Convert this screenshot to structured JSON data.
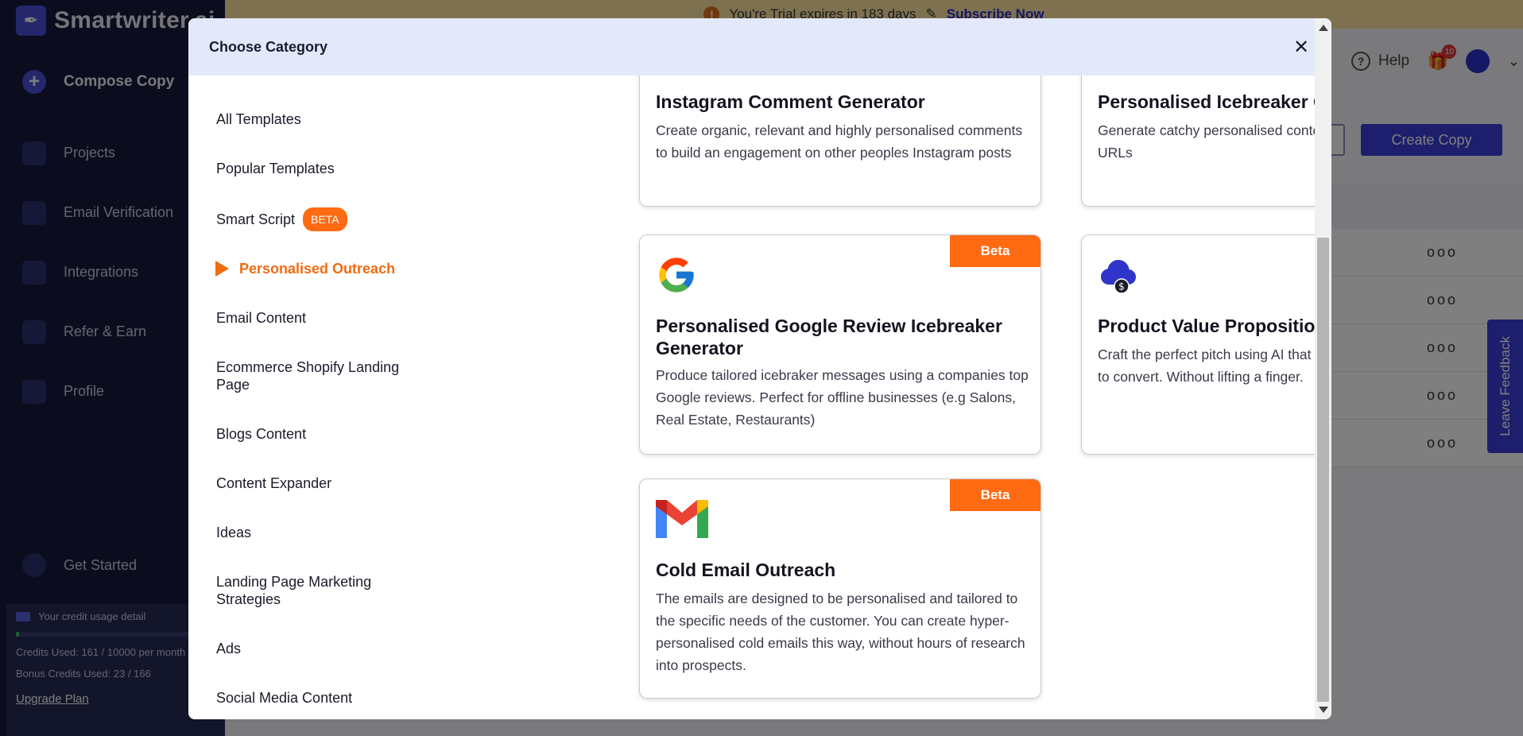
{
  "app": {
    "brand": "Smartwriter.ai",
    "compose_label": "Compose Copy",
    "nav": [
      "Projects",
      "Email Verification",
      "Integrations",
      "Refer & Earn",
      "Profile"
    ],
    "get_started": "Get Started",
    "credit": {
      "title": "Your credit usage detail",
      "credits_used": "Credits Used: 161 / 10000 per month",
      "bonus_used": "Bonus Credits Used: 23 / 166",
      "usage_fraction": 0.016,
      "upgrade": "Upgrade Plan"
    },
    "trial": {
      "message": "You're Trial expires in 183 days",
      "subscribe": "Subscribe Now"
    },
    "header": {
      "help": "Help",
      "gift_count": "10",
      "create_copy": "Create Copy"
    },
    "table_row_action": "ooo",
    "feedback": "Leave Feedback"
  },
  "modal": {
    "title": "Choose Category",
    "categories": [
      {
        "label": "All Templates"
      },
      {
        "label": "Popular Templates"
      },
      {
        "label": "Smart Script",
        "badge": "BETA"
      },
      {
        "label": "Personalised Outreach",
        "active": true
      },
      {
        "label": "Email Content"
      },
      {
        "label": "Ecommerce Shopify Landing Page"
      },
      {
        "label": "Blogs Content"
      },
      {
        "label": "Content Expander"
      },
      {
        "label": "Ideas"
      },
      {
        "label": "Landing Page Marketing Strategies"
      },
      {
        "label": "Ads"
      },
      {
        "label": "Social Media Content"
      }
    ],
    "cards": [
      {
        "title": "Instagram Comment Generator",
        "desc": "Create organic, relevant and highly personalised comments to build an engagement on other peoples Instagram posts"
      },
      {
        "title": "Personalised Icebreaker Generator",
        "desc": "Generate catchy personalised content for the given website URLs"
      },
      {
        "title": "Personalised Google Review Icebreaker Generator",
        "desc": "Produce tailored icebraker messages using a companies top Google reviews. Perfect for offline businesses (e.g Salons, Real Estate, Restaurants)",
        "badge": "Beta",
        "icon": "google-icon"
      },
      {
        "title": "Product Value Proposition",
        "desc": "Craft the perfect pitch using AI that gets your prospect ready to convert. Without lifting a finger.",
        "icon": "cloud-dollar-icon"
      },
      {
        "title": "Cold Email Outreach",
        "desc": "The emails are designed to be personalised and tailored to the specific needs of the customer. You can create hyper-personalised cold emails this way, without hours of research into prospects.",
        "badge": "Beta",
        "icon": "gmail-icon"
      }
    ]
  },
  "colors": {
    "accent_orange": "#ff6a13",
    "brand_blue": "#3a3fd8",
    "modal_header": "#e3e9fb"
  }
}
